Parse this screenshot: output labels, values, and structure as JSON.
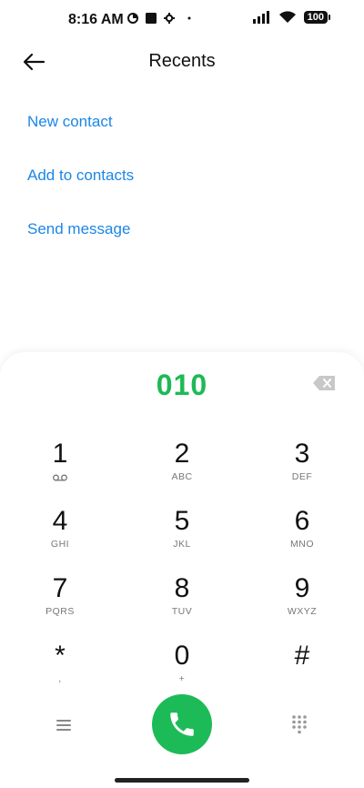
{
  "status_bar": {
    "time": "8:16 AM",
    "battery": "100"
  },
  "header": {
    "title": "Recents"
  },
  "actions": [
    {
      "label": "New contact"
    },
    {
      "label": "Add to contacts"
    },
    {
      "label": "Send message"
    }
  ],
  "dialer": {
    "number": "010",
    "keys": [
      {
        "digit": "1",
        "letters": ""
      },
      {
        "digit": "2",
        "letters": "ABC"
      },
      {
        "digit": "3",
        "letters": "DEF"
      },
      {
        "digit": "4",
        "letters": "GHI"
      },
      {
        "digit": "5",
        "letters": "JKL"
      },
      {
        "digit": "6",
        "letters": "MNO"
      },
      {
        "digit": "7",
        "letters": "PQRS"
      },
      {
        "digit": "8",
        "letters": "TUV"
      },
      {
        "digit": "9",
        "letters": "WXYZ"
      },
      {
        "digit": "*",
        "letters": ","
      },
      {
        "digit": "0",
        "letters": "+"
      },
      {
        "digit": "#",
        "letters": ""
      }
    ]
  },
  "colors": {
    "accent_blue": "#1b86e8",
    "call_green": "#1dbb57",
    "number_green": "#1eb955"
  }
}
